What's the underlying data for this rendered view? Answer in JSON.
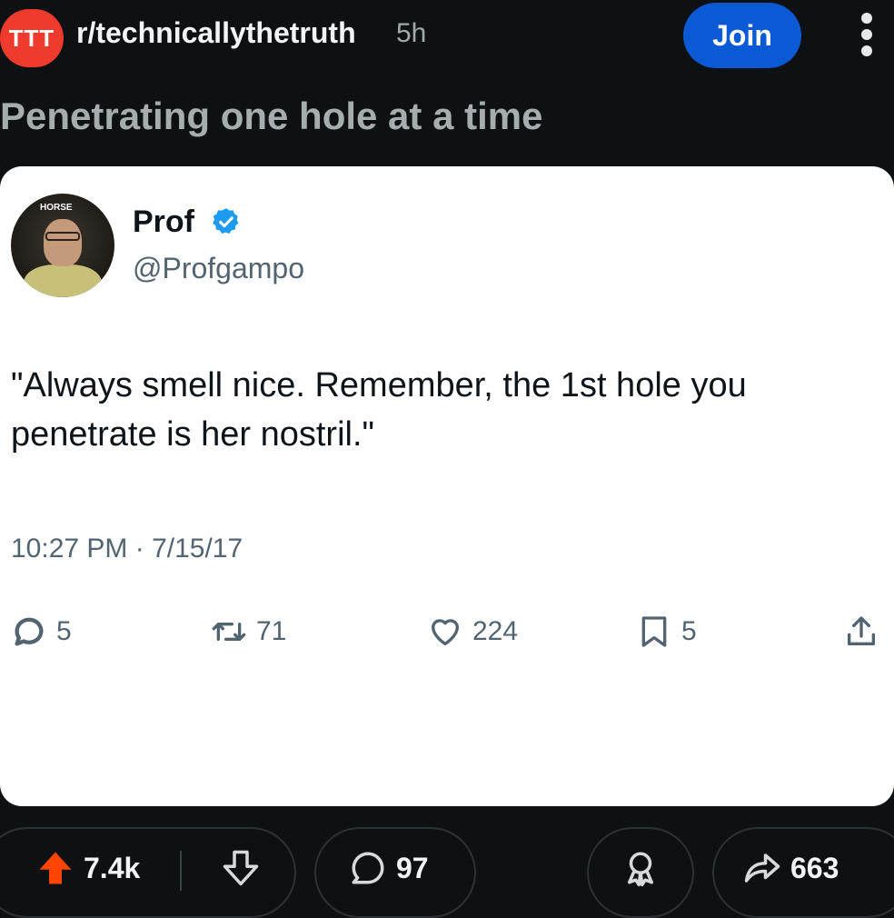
{
  "header": {
    "subreddit_icon_text": "TTT",
    "subreddit": "r/technicallythetruth",
    "age": "5h",
    "join_label": "Join"
  },
  "post": {
    "title": "Penetrating one hole at a time"
  },
  "tweet": {
    "avatar_text": "HORSE",
    "name": "Prof",
    "handle": "@Profgampo",
    "text": "\"Always smell nice. Remember, the 1st hole you penetrate is her nostril.\"",
    "timestamp": "10:27 PM · 7/15/17",
    "replies": "5",
    "retweets": "71",
    "likes": "224",
    "bookmarks": "5"
  },
  "actions": {
    "votes": "7.4k",
    "comments": "97",
    "shares": "663"
  },
  "colors": {
    "background": "#0e1113",
    "join": "#0a5ad6",
    "upvote": "#ff4500",
    "verified": "#1d9bf0"
  }
}
